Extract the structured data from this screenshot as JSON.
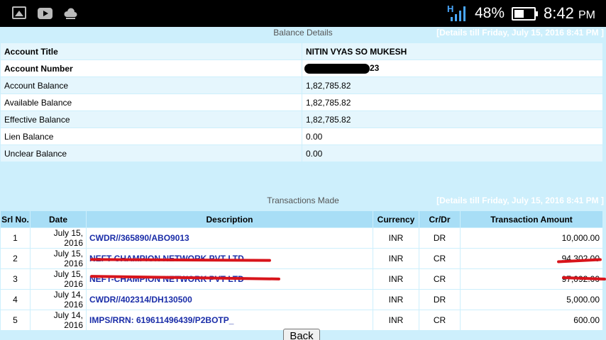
{
  "status_bar": {
    "battery_percent": "48%",
    "time": "8:42",
    "ampm": "PM",
    "network_label": "H"
  },
  "balance_section": {
    "title": "Balance Details",
    "as_of": "[Details till Friday, July 15, 2016 8:41 PM ]",
    "rows": [
      {
        "label": "Account Title",
        "value": "NITIN VYAS SO MUKESH"
      },
      {
        "label": "Account Number",
        "value": "23"
      },
      {
        "label": "Account Balance",
        "value": "1,82,785.82"
      },
      {
        "label": "Available Balance",
        "value": "1,82,785.82"
      },
      {
        "label": "Effective Balance",
        "value": "1,82,785.82"
      },
      {
        "label": "Lien Balance",
        "value": "0.00"
      },
      {
        "label": "Unclear Balance",
        "value": "0.00"
      }
    ]
  },
  "transactions_section": {
    "title": "Transactions Made",
    "as_of": "[Details till Friday, July 15, 2016 8:41 PM ]",
    "headers": [
      "Srl No.",
      "Date",
      "Description",
      "Currency",
      "Cr/Dr",
      "Transaction Amount"
    ],
    "rows": [
      {
        "srl": "1",
        "date": "July 15, 2016",
        "desc": "CWDR//365890/ABO9013",
        "currency": "INR",
        "crdr": "DR",
        "amount": "10,000.00"
      },
      {
        "srl": "2",
        "date": "July 15, 2016",
        "desc": "NEFT-CHAMPION NETWORK PVT LTD",
        "currency": "INR",
        "crdr": "CR",
        "amount": "94,302.00"
      },
      {
        "srl": "3",
        "date": "July 15, 2016",
        "desc": "NEFT-CHAMPION NETWORK PVT LTD",
        "currency": "INR",
        "crdr": "CR",
        "amount": "97,092.00"
      },
      {
        "srl": "4",
        "date": "July 14, 2016",
        "desc": "CWDR//402314/DH130500",
        "currency": "INR",
        "crdr": "DR",
        "amount": "5,000.00"
      },
      {
        "srl": "5",
        "date": "July 14, 2016",
        "desc": "IMPS/RRN: 619611496439/P2BOTP_",
        "currency": "INR",
        "crdr": "CR",
        "amount": "600.00"
      }
    ]
  },
  "back_button": {
    "label": "Back"
  },
  "icons": [
    "gallery-icon",
    "youtube-icon",
    "cloud-icon",
    "network-signal-icon",
    "battery-icon"
  ]
}
